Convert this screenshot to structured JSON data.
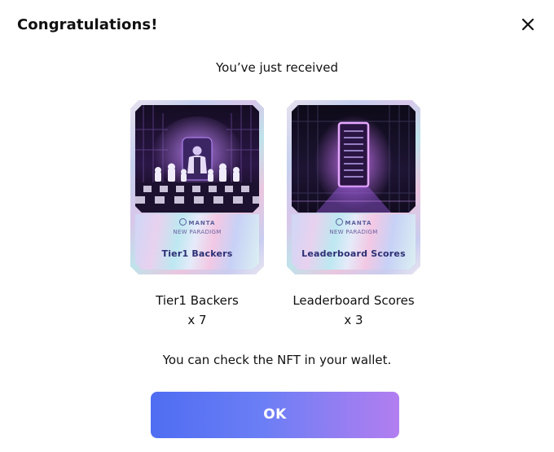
{
  "dialog": {
    "title": "Congratulations!",
    "subtitle": "You’ve just received",
    "note": "You can check the NFT in your wallet.",
    "ok_label": "OK"
  },
  "nfts": [
    {
      "brand": "MANTA",
      "collection": "NEW PARADIGM",
      "card_title": "Tier1 Backers",
      "name": "Tier1 Backers",
      "quantity": "x 7",
      "art_icon": "throne-chess-icon"
    },
    {
      "brand": "MANTA",
      "collection": "NEW PARADIGM",
      "card_title": "Leaderboard Scores",
      "name": "Leaderboard Scores",
      "quantity": "x 3",
      "art_icon": "glowing-monolith-icon"
    }
  ],
  "colors": {
    "button_gradient_start": "#4f6df2",
    "button_gradient_end": "#b27ef0",
    "card_text": "#2c2f74",
    "art_glow": "#a35cff"
  }
}
